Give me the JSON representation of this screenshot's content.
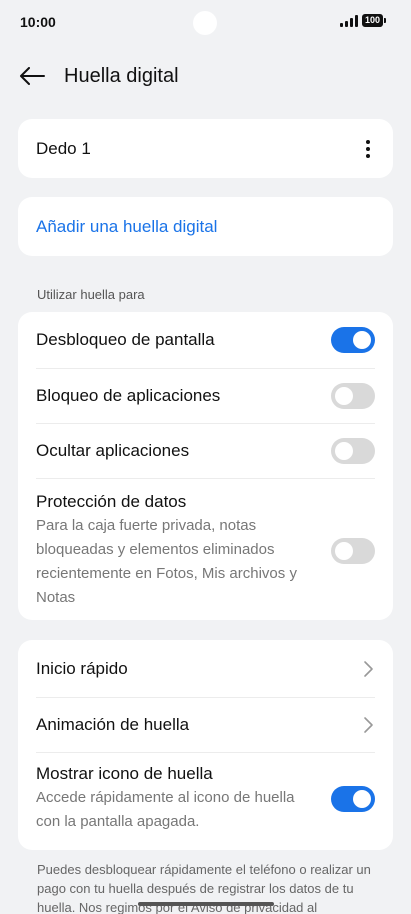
{
  "status_bar": {
    "time": "10:00",
    "battery": "100"
  },
  "header": {
    "title": "Huella digital"
  },
  "finger_card": {
    "finger_name": "Dedo 1"
  },
  "add_card": {
    "label": "Añadir una huella digital"
  },
  "section_label": "Utilizar huella para",
  "use_for": [
    {
      "title": "Desbloqueo de pantalla",
      "enabled": true
    },
    {
      "title": "Bloqueo de aplicaciones",
      "enabled": false
    },
    {
      "title": "Ocultar aplicaciones",
      "enabled": false
    },
    {
      "title": "Protección de datos",
      "description": "Para la caja fuerte privada, notas bloqueadas y elementos eliminados recientemente en Fotos, Mis archivos y Notas",
      "enabled": false
    }
  ],
  "more_settings": [
    {
      "title": "Inicio rápido"
    },
    {
      "title": "Animación de huella"
    },
    {
      "title": "Mostrar icono de huella",
      "description": "Accede rápidamente al icono de huella con la pantalla apagada.",
      "enabled": true
    }
  ],
  "footer": "Puedes desbloquear rápidamente el teléfono o realizar un pago con tu huella después de registrar los datos de tu huella. Nos regimos por el Aviso de privacidad al",
  "colors": {
    "accent": "#1a73e8",
    "background": "#f1f2f4",
    "toggle_off": "#d9d9d9"
  }
}
